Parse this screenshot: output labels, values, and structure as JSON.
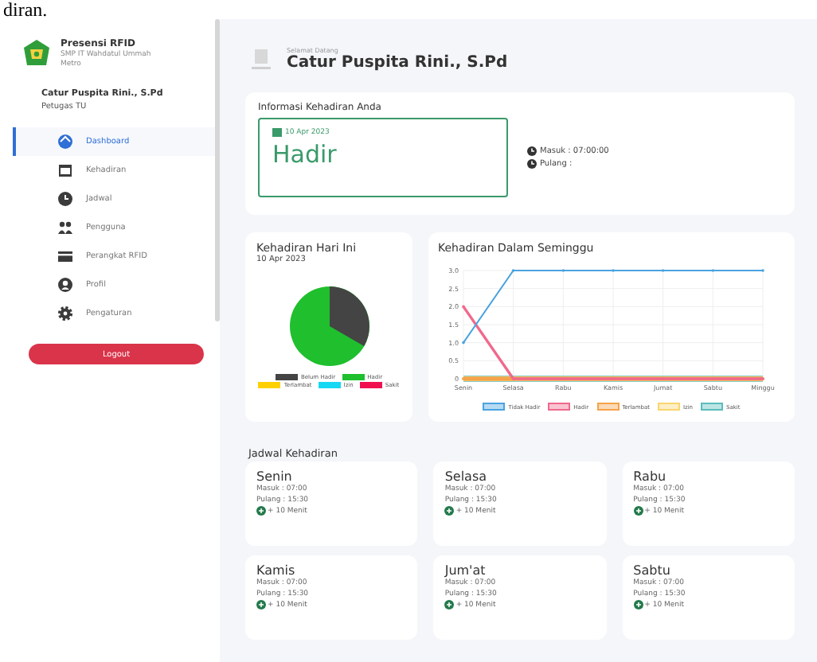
{
  "caption_fragment": "diran.",
  "sidebar": {
    "app_title": "Presensi RFID",
    "school": "SMP IT Wahdatul Ummah Metro",
    "user_name": "Catur Puspita Rini., S.Pd",
    "user_role": "Petugas TU",
    "items": [
      {
        "label": "Dashboard",
        "selected": true
      },
      {
        "label": "Kehadiran",
        "selected": false
      },
      {
        "label": "Jadwal",
        "selected": false
      },
      {
        "label": "Pengguna",
        "selected": false
      },
      {
        "label": "Perangkat RFID",
        "selected": false
      },
      {
        "label": "Profil",
        "selected": false
      },
      {
        "label": "Pengaturan",
        "selected": false
      }
    ],
    "logout": "Logout"
  },
  "header": {
    "greeting": "Selamat Datang",
    "name": "Catur Puspita Rini., S.Pd"
  },
  "attendance_info": {
    "title": "Informasi Kehadiran Anda",
    "date": "10 Apr 2023",
    "status": "Hadir",
    "check_in": "Masuk : 07:00:00",
    "check_out": "Pulang :"
  },
  "today": {
    "title": "Kehadiran Hari Ini",
    "date": "10 Apr 2023",
    "legend": [
      {
        "label": "Belum Hadir",
        "color": "#444444"
      },
      {
        "label": "Hadir",
        "color": "#1fbf2e"
      },
      {
        "label": "Terlambat",
        "color": "#ffd000"
      },
      {
        "label": "Izin",
        "color": "#17d8f2"
      },
      {
        "label": "Sakit",
        "color": "#f0104f"
      }
    ]
  },
  "week": {
    "title": "Kehadiran Dalam Seminggu",
    "chart_data": {
      "type": "line",
      "grid": true,
      "categories": [
        "Senin",
        "Selasa",
        "Rabu",
        "Kamis",
        "Jumat",
        "Sabtu",
        "Minggu"
      ],
      "ylim": [
        0,
        3
      ],
      "yticks": [
        {
          "value": 0,
          "label": "0"
        },
        {
          "value": 0.5,
          "label": "0.5"
        },
        {
          "value": 1,
          "label": "1.0"
        },
        {
          "value": 1.5,
          "label": "1.5"
        },
        {
          "value": 2,
          "label": "2.0"
        },
        {
          "value": 2.5,
          "label": "2.5"
        },
        {
          "value": 3,
          "label": "3.0"
        }
      ],
      "series": [
        {
          "name": "Tidak Hadir",
          "color": "#4aa3e0",
          "values": [
            1,
            3,
            3,
            3,
            3,
            3,
            3
          ]
        },
        {
          "name": "Hadir",
          "color": "#f0698c",
          "values": [
            2,
            0,
            0,
            0,
            0,
            0,
            0
          ]
        },
        {
          "name": "Terlambat",
          "color": "#f5a24a",
          "values": [
            0,
            0,
            0,
            0,
            0,
            0,
            0
          ]
        },
        {
          "name": "Izin",
          "color": "#f9d56e",
          "values": [
            0,
            0,
            0,
            0,
            0,
            0,
            0
          ]
        },
        {
          "name": "Sakit",
          "color": "#5bbcbc",
          "values": [
            0,
            0,
            0,
            0,
            0,
            0,
            0
          ]
        }
      ]
    }
  },
  "schedule": {
    "title": "Jadwal Kehadiran",
    "days": [
      {
        "day": "Senin",
        "in": "Masuk : 07:00",
        "out": "Pulang : 15:30",
        "tolerance": "+ 10 Menit"
      },
      {
        "day": "Selasa",
        "in": "Masuk : 07:00",
        "out": "Pulang : 15:30",
        "tolerance": "+ 10 Menit"
      },
      {
        "day": "Rabu",
        "in": "Masuk : 07:00",
        "out": "Pulang : 15:30",
        "tolerance": "+ 10 Menit"
      },
      {
        "day": "Kamis",
        "in": "Masuk : 07:00",
        "out": "Pulang : 15:30",
        "tolerance": "+ 10 Menit"
      },
      {
        "day": "Jum'at",
        "in": "Masuk : 07:00",
        "out": "Pulang : 15:30",
        "tolerance": "+ 10 Menit"
      },
      {
        "day": "Sabtu",
        "in": "Masuk : 07:00",
        "out": "Pulang : 15:30",
        "tolerance": "+ 10 Menit"
      }
    ]
  }
}
